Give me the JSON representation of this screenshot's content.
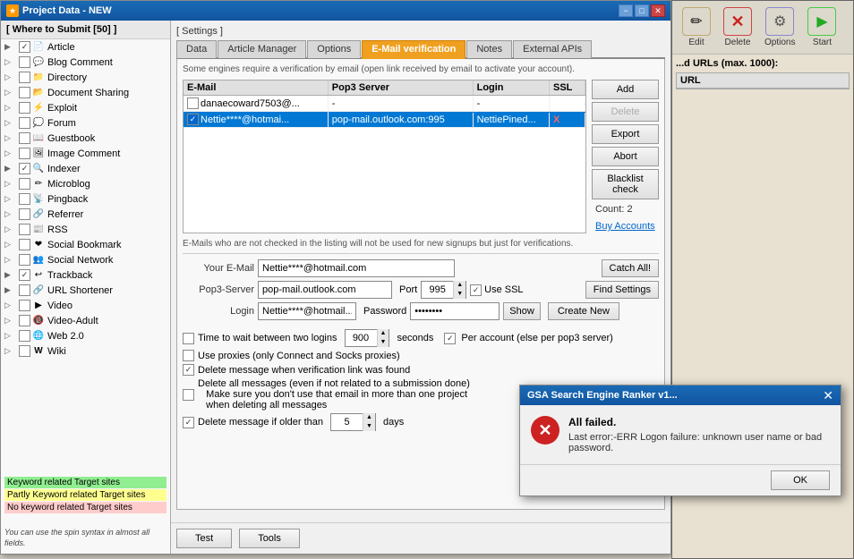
{
  "window": {
    "title": "Project Data - NEW",
    "icon": "★"
  },
  "sidebar": {
    "header": "[ Where to Submit  [50] ]",
    "items": [
      {
        "id": "article",
        "label": "Article",
        "checked": true,
        "expandable": true,
        "icon": "📄",
        "indent": 0
      },
      {
        "id": "blog-comment",
        "label": "Blog Comment",
        "checked": false,
        "expandable": true,
        "icon": "💬",
        "indent": 0
      },
      {
        "id": "directory",
        "label": "Directory",
        "checked": false,
        "expandable": true,
        "icon": "📁",
        "indent": 0
      },
      {
        "id": "document-sharing",
        "label": "Document Sharing",
        "checked": false,
        "expandable": true,
        "icon": "📂",
        "indent": 0
      },
      {
        "id": "exploit",
        "label": "Exploit",
        "checked": false,
        "expandable": true,
        "icon": "⚡",
        "indent": 0
      },
      {
        "id": "forum",
        "label": "Forum",
        "checked": false,
        "expandable": true,
        "icon": "💭",
        "indent": 0
      },
      {
        "id": "guestbook",
        "label": "Guestbook",
        "checked": false,
        "expandable": true,
        "icon": "📖",
        "indent": 0
      },
      {
        "id": "image-comment",
        "label": "Image Comment",
        "checked": false,
        "expandable": true,
        "icon": "🖼",
        "indent": 0
      },
      {
        "id": "indexer",
        "label": "Indexer",
        "checked": true,
        "expandable": true,
        "icon": "🔍",
        "indent": 0
      },
      {
        "id": "microblog",
        "label": "Microblog",
        "checked": false,
        "expandable": true,
        "icon": "✏️",
        "indent": 0
      },
      {
        "id": "pingback",
        "label": "Pingback",
        "checked": false,
        "expandable": true,
        "icon": "📡",
        "indent": 0
      },
      {
        "id": "referrer",
        "label": "Referrer",
        "checked": false,
        "expandable": true,
        "icon": "🔗",
        "indent": 0
      },
      {
        "id": "rss",
        "label": "RSS",
        "checked": false,
        "expandable": true,
        "icon": "📰",
        "indent": 0
      },
      {
        "id": "social-bookmark",
        "label": "Social Bookmark",
        "checked": false,
        "expandable": true,
        "icon": "❤️",
        "indent": 0
      },
      {
        "id": "social-network",
        "label": "Social Network",
        "checked": false,
        "expandable": true,
        "icon": "👥",
        "indent": 0
      },
      {
        "id": "trackback",
        "label": "Trackback",
        "checked": true,
        "expandable": true,
        "icon": "↩️",
        "indent": 0
      },
      {
        "id": "url-shortener",
        "label": "URL Shortener",
        "checked": false,
        "expandable": true,
        "icon": "🔗",
        "indent": 0
      },
      {
        "id": "video",
        "label": "Video",
        "checked": false,
        "expandable": true,
        "icon": "▶️",
        "indent": 0
      },
      {
        "id": "video-adult",
        "label": "Video-Adult",
        "checked": false,
        "expandable": true,
        "icon": "🔞",
        "indent": 0
      },
      {
        "id": "web20",
        "label": "Web 2.0",
        "checked": false,
        "expandable": true,
        "icon": "🌐",
        "indent": 0
      },
      {
        "id": "wiki",
        "label": "Wiki",
        "checked": false,
        "expandable": true,
        "icon": "W",
        "indent": 0
      }
    ]
  },
  "legend": {
    "items": [
      {
        "label": "Keyword related Target sites",
        "color": "green"
      },
      {
        "label": "Partly Keyword related Target sites",
        "color": "yellow"
      },
      {
        "label": "No keyword related Target sites",
        "color": "red"
      }
    ],
    "note": "You can use the spin syntax in almost all fields."
  },
  "settings_label": "[ Settings ]",
  "tabs": [
    {
      "id": "data",
      "label": "Data"
    },
    {
      "id": "article-manager",
      "label": "Article Manager"
    },
    {
      "id": "options",
      "label": "Options"
    },
    {
      "id": "email-verification",
      "label": "E-Mail verification",
      "active": true
    },
    {
      "id": "notes",
      "label": "Notes"
    },
    {
      "id": "external-apis",
      "label": "External APIs"
    }
  ],
  "email_tab": {
    "info_text": "Some engines require a verification by email (open link received by email to activate your account).",
    "table": {
      "headers": [
        "E-Mail",
        "Pop3 Server",
        "Login",
        "SSL"
      ],
      "rows": [
        {
          "checked": false,
          "email": "danaecoward7503@...",
          "pop3": "-",
          "login": "-",
          "ssl": "",
          "selected": false
        },
        {
          "checked": true,
          "email": "Nettie****@hotmai...",
          "pop3": "pop-mail.outlook.com:995",
          "login": "NettiePined...",
          "ssl": "X",
          "selected": true
        }
      ]
    },
    "buttons": {
      "add": "Add",
      "delete": "Delete",
      "export": "Export",
      "abort": "Abort",
      "blacklist_check": "Blacklist check",
      "count": "Count: 2",
      "buy_accounts": "Buy Accounts"
    },
    "form_note": "E-Mails who are not checked in the listing will not be used for new signups but just for verifications.",
    "form": {
      "your_email_label": "Your E-Mail",
      "your_email_value": "Nettie****@hotmail.com",
      "catch_all_btn": "Catch All!",
      "pop3_label": "Pop3-Server",
      "pop3_value": "pop-mail.outlook.com",
      "port_label": "Port",
      "port_value": "995",
      "use_ssl_label": "Use SSL",
      "use_ssl_checked": true,
      "find_settings_btn": "Find Settings",
      "login_label": "Login",
      "login_value": "Nettie****@hotmail...",
      "password_label": "Password",
      "password_value": "••••••••",
      "show_btn": "Show",
      "create_new_btn": "Create New"
    },
    "options": [
      {
        "id": "time-wait",
        "label_pre": "Time to wait between two logins",
        "value": "900",
        "label_post": "seconds",
        "checked": false,
        "extra": "Per account (else per pop3 server)",
        "extra_checked": true
      },
      {
        "id": "use-proxies",
        "label": "Use proxies (only Connect and Socks proxies)",
        "checked": false
      },
      {
        "id": "delete-found",
        "label": "Delete message when verification link was found",
        "checked": true
      },
      {
        "id": "delete-all",
        "label": "Delete all messages (even if not related to a submission done)\n        Make sure you don't use that email in more than one project\n        when deleting all messages",
        "checked": false
      },
      {
        "id": "delete-older",
        "label_pre": "Delete message if older than",
        "value": "5",
        "label_post": "days",
        "checked": true
      }
    ]
  },
  "bottom_buttons": {
    "test": "Test",
    "tools": "Tools"
  },
  "toolbar": {
    "buttons": [
      {
        "id": "edit",
        "label": "Edit",
        "icon": "✏️"
      },
      {
        "id": "delete",
        "label": "Delete",
        "icon": "✕"
      },
      {
        "id": "options",
        "label": "Options",
        "icon": "⚙"
      },
      {
        "id": "start",
        "label": "Start",
        "icon": "▶"
      }
    ],
    "urls_section": {
      "title": "...d URLs (max. 1000):",
      "column": "URL"
    }
  },
  "error_dialog": {
    "title": "GSA Search Engine Ranker v1...",
    "main_text": "All failed.",
    "sub_text": "Last error:-ERR Logon failure: unknown user name or bad password.",
    "ok_btn": "OK"
  }
}
